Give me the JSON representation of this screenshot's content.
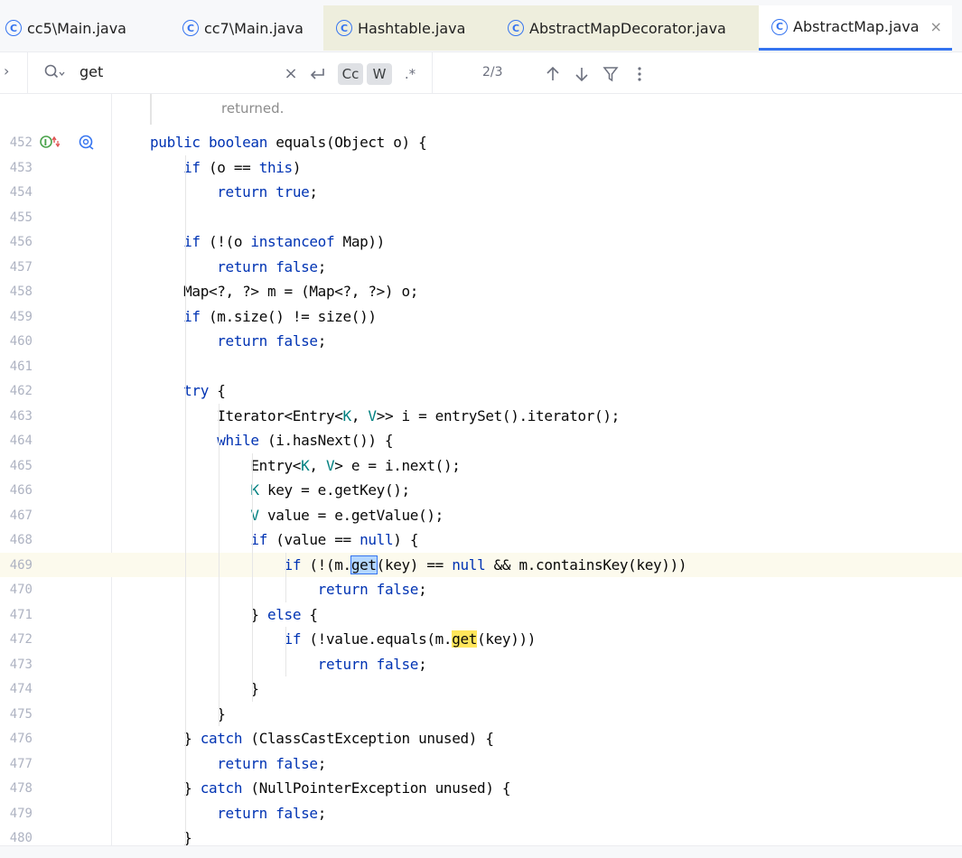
{
  "tabs": [
    {
      "label": "cc5\\Main.java"
    },
    {
      "label": "cc7\\Main.java"
    },
    {
      "label": "Hashtable.java"
    },
    {
      "label": "AbstractMapDecorator.java"
    },
    {
      "label": "AbstractMap.java",
      "active": true,
      "close": "×"
    }
  ],
  "search": {
    "query": "get",
    "clear": "×",
    "match_case": "Cc",
    "words": "W",
    "regex": ".*",
    "counter": "2/3"
  },
  "doc_text": "returned.",
  "lines": [
    {
      "n": "452",
      "code": "public boolean equals(Object o) {"
    },
    {
      "n": "453",
      "code": "    if (o == this)"
    },
    {
      "n": "454",
      "code": "        return true;"
    },
    {
      "n": "455",
      "code": ""
    },
    {
      "n": "456",
      "code": "    if (!(o instanceof Map))"
    },
    {
      "n": "457",
      "code": "        return false;"
    },
    {
      "n": "458",
      "code": "    Map<?, ?> m = (Map<?, ?>) o;"
    },
    {
      "n": "459",
      "code": "    if (m.size() != size())"
    },
    {
      "n": "460",
      "code": "        return false;"
    },
    {
      "n": "461",
      "code": ""
    },
    {
      "n": "462",
      "code": "    try {"
    },
    {
      "n": "463",
      "code": "        Iterator<Entry<K, V>> i = entrySet().iterator();"
    },
    {
      "n": "464",
      "code": "        while (i.hasNext()) {"
    },
    {
      "n": "465",
      "code": "            Entry<K, V> e = i.next();"
    },
    {
      "n": "466",
      "code": "            K key = e.getKey();"
    },
    {
      "n": "467",
      "code": "            V value = e.getValue();"
    },
    {
      "n": "468",
      "code": "            if (value == null) {"
    },
    {
      "n": "469",
      "code": "                if (!(m.get(key) == null && m.containsKey(key)))"
    },
    {
      "n": "470",
      "code": "                    return false;"
    },
    {
      "n": "471",
      "code": "            } else {"
    },
    {
      "n": "472",
      "code": "                if (!value.equals(m.get(key)))"
    },
    {
      "n": "473",
      "code": "                    return false;"
    },
    {
      "n": "474",
      "code": "            }"
    },
    {
      "n": "475",
      "code": "        }"
    },
    {
      "n": "476",
      "code": "    } catch (ClassCastException unused) {"
    },
    {
      "n": "477",
      "code": "        return false;"
    },
    {
      "n": "478",
      "code": "    } catch (NullPointerException unused) {"
    },
    {
      "n": "479",
      "code": "        return false;"
    },
    {
      "n": "480",
      "code": "    }"
    }
  ],
  "current_line": "469",
  "colors": {
    "keyword": "#0033b3",
    "type_param": "#008080",
    "current_line_bg": "#fcfaed",
    "selected_match": "#b4d7ff",
    "other_match": "#ffe65b",
    "accent": "#3574f0"
  }
}
